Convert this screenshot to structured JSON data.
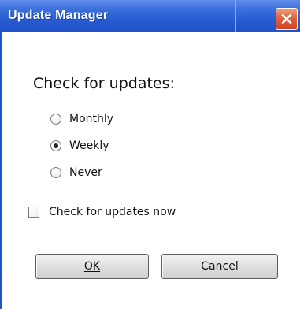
{
  "window": {
    "title": "Update Manager",
    "close_icon": "close-icon",
    "accent_color": "#2659cf",
    "close_color": "#d2431f"
  },
  "dialog": {
    "heading": "Check for updates:",
    "frequency_options": [
      {
        "label": "Monthly",
        "selected": false
      },
      {
        "label": "Weekly",
        "selected": true
      },
      {
        "label": "Never",
        "selected": false
      }
    ],
    "check_now": {
      "label": "Check for updates now",
      "checked": false
    },
    "buttons": {
      "ok_label": "OK",
      "cancel_label": "Cancel"
    }
  }
}
